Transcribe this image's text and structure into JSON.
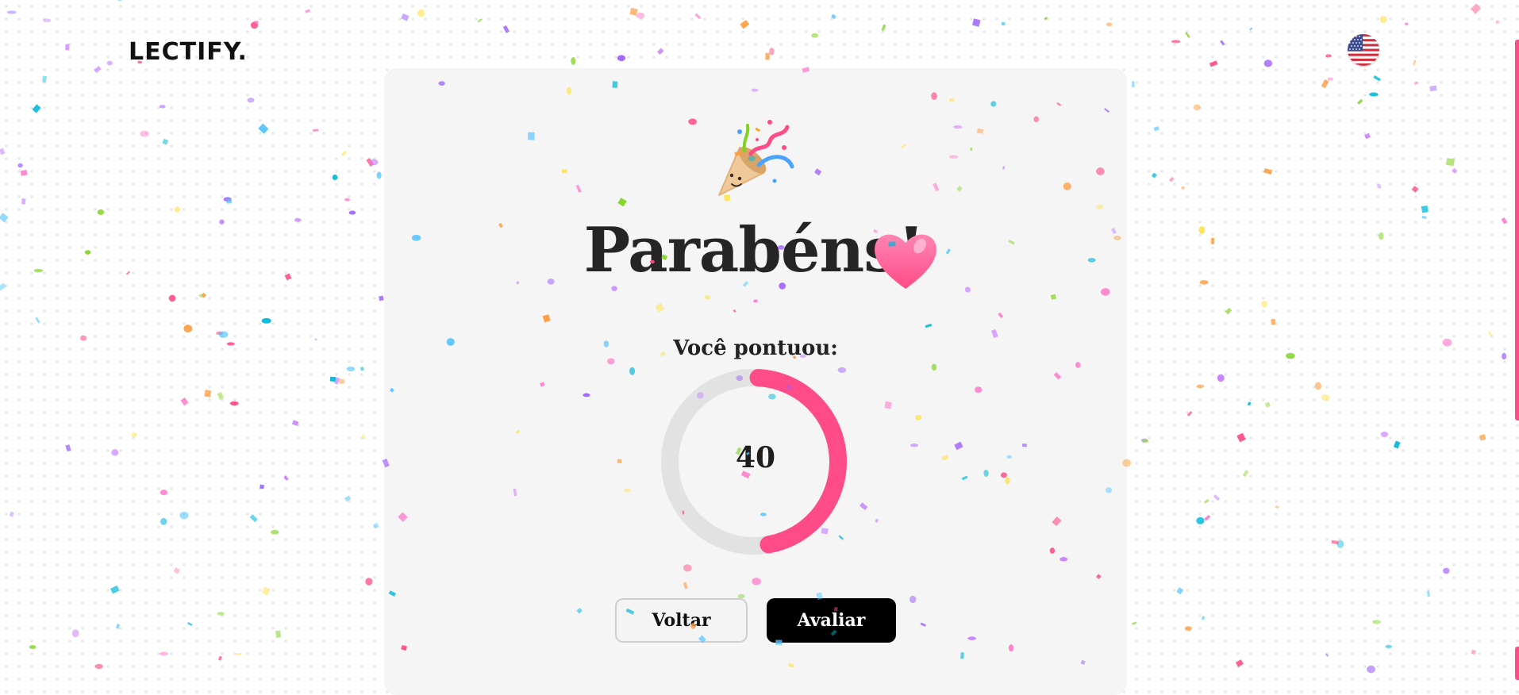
{
  "header": {
    "logo_text": "LECTIFY.",
    "language_icon": "us-flag-icon"
  },
  "result": {
    "title": "Parabéns!",
    "title_icon": "pink-heart-icon",
    "celebration_icon": "party-popper-icon",
    "score_label": "Você pontuou:",
    "score_value": "40",
    "score_progress_percent": 40,
    "progress_color": "#ff4b87",
    "track_color": "#e2e2e2"
  },
  "actions": {
    "back_label": "Voltar",
    "rate_label": "Avaliar"
  }
}
